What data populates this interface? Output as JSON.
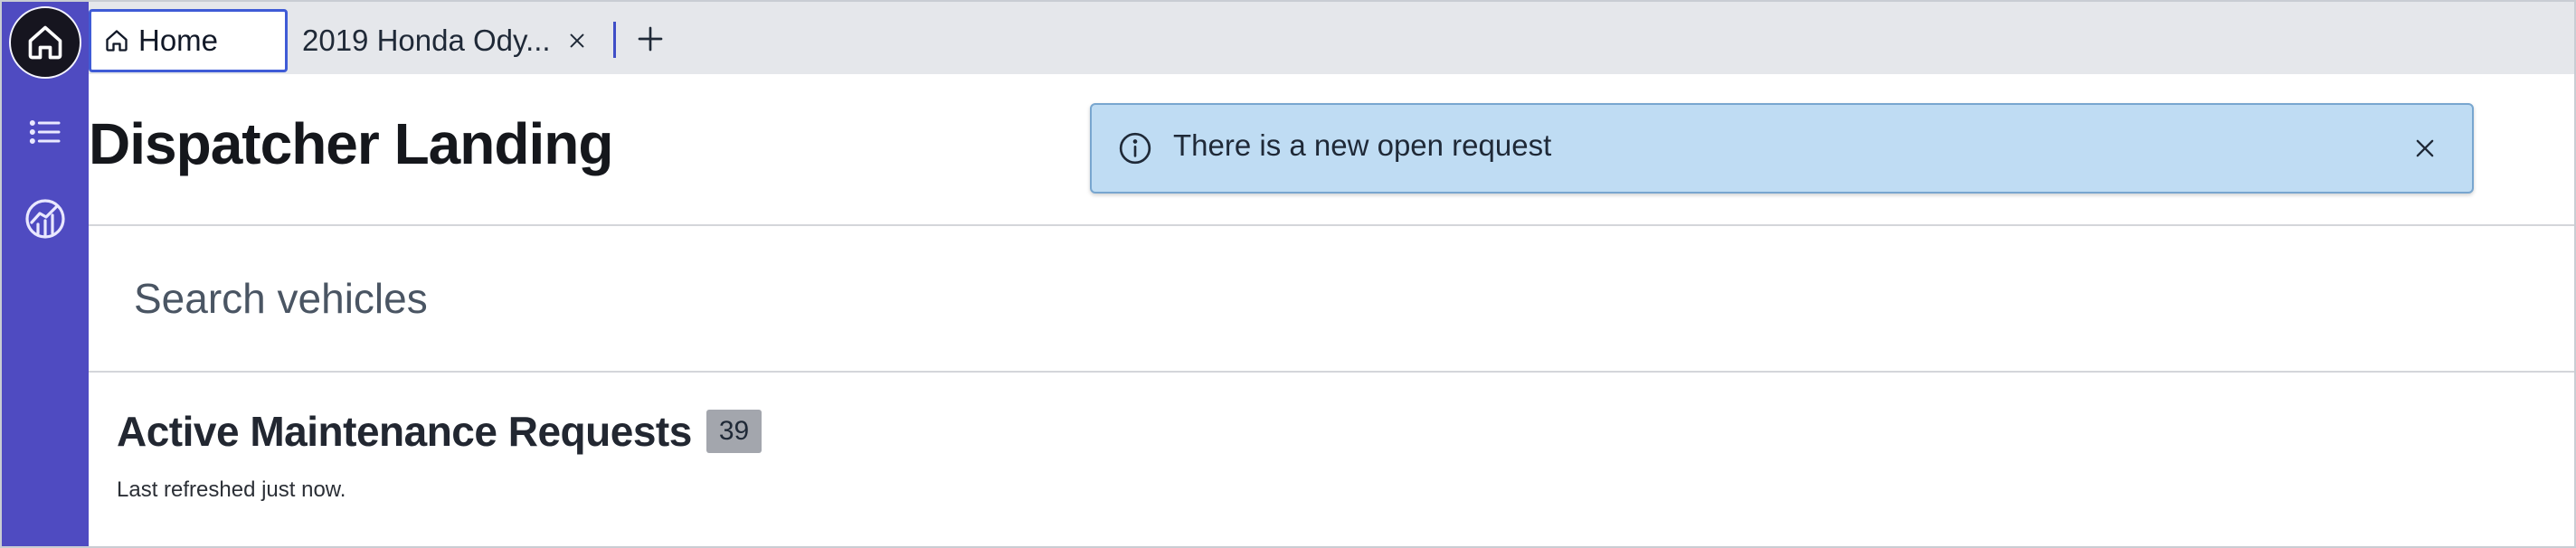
{
  "tabs": [
    {
      "label": "Home",
      "icon": "home-icon",
      "active": true
    },
    {
      "label": "2019 Honda Ody...",
      "icon": null,
      "active": false
    }
  ],
  "rail": {
    "items": [
      "home-icon",
      "list-icon",
      "analytics-icon"
    ]
  },
  "page": {
    "title": "Dispatcher Landing"
  },
  "toast": {
    "icon": "info-icon",
    "message": "There is a new open request"
  },
  "search": {
    "placeholder": "Search vehicles",
    "value": ""
  },
  "requests": {
    "title": "Active Maintenance Requests",
    "count": "39",
    "refreshed": "Last refreshed just now."
  },
  "colors": {
    "rail": "#4f4bc1",
    "active_tab_border": "#3f5bd6",
    "toast_bg": "#bfdcf3",
    "badge_bg": "#a3a6ad"
  }
}
